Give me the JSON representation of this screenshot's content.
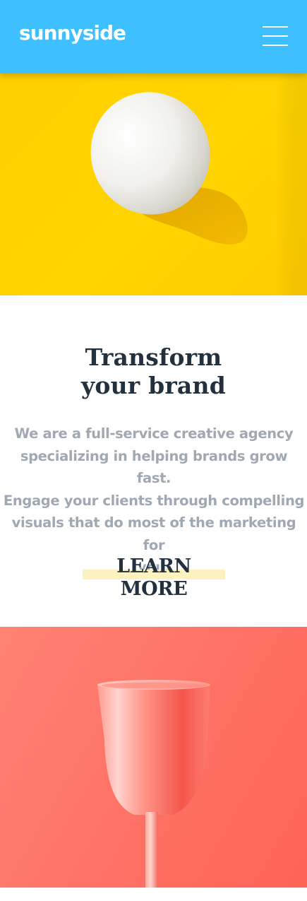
{
  "header": {
    "logo": "sunnyside",
    "menu_icon": "hamburger-menu-icon",
    "background": "#3ebfff"
  },
  "hero_image": {
    "subject": "egg",
    "background": "#ffd100"
  },
  "intro": {
    "headline_line1": "Transform",
    "headline_line2": "your brand",
    "body_lines": [
      "We are a full-service creative agency",
      "specializing in helping brands grow fast.",
      "Engage your clients through compelling",
      "visuals that do most of the marketing for",
      "you."
    ],
    "cta_label": "LEARN MORE",
    "cta_highlight": "#fdf1bf",
    "headline_color": "#23303e",
    "body_color": "#9fa8b3"
  },
  "secondary_image": {
    "subject": "glass",
    "background": "#ff7468"
  }
}
